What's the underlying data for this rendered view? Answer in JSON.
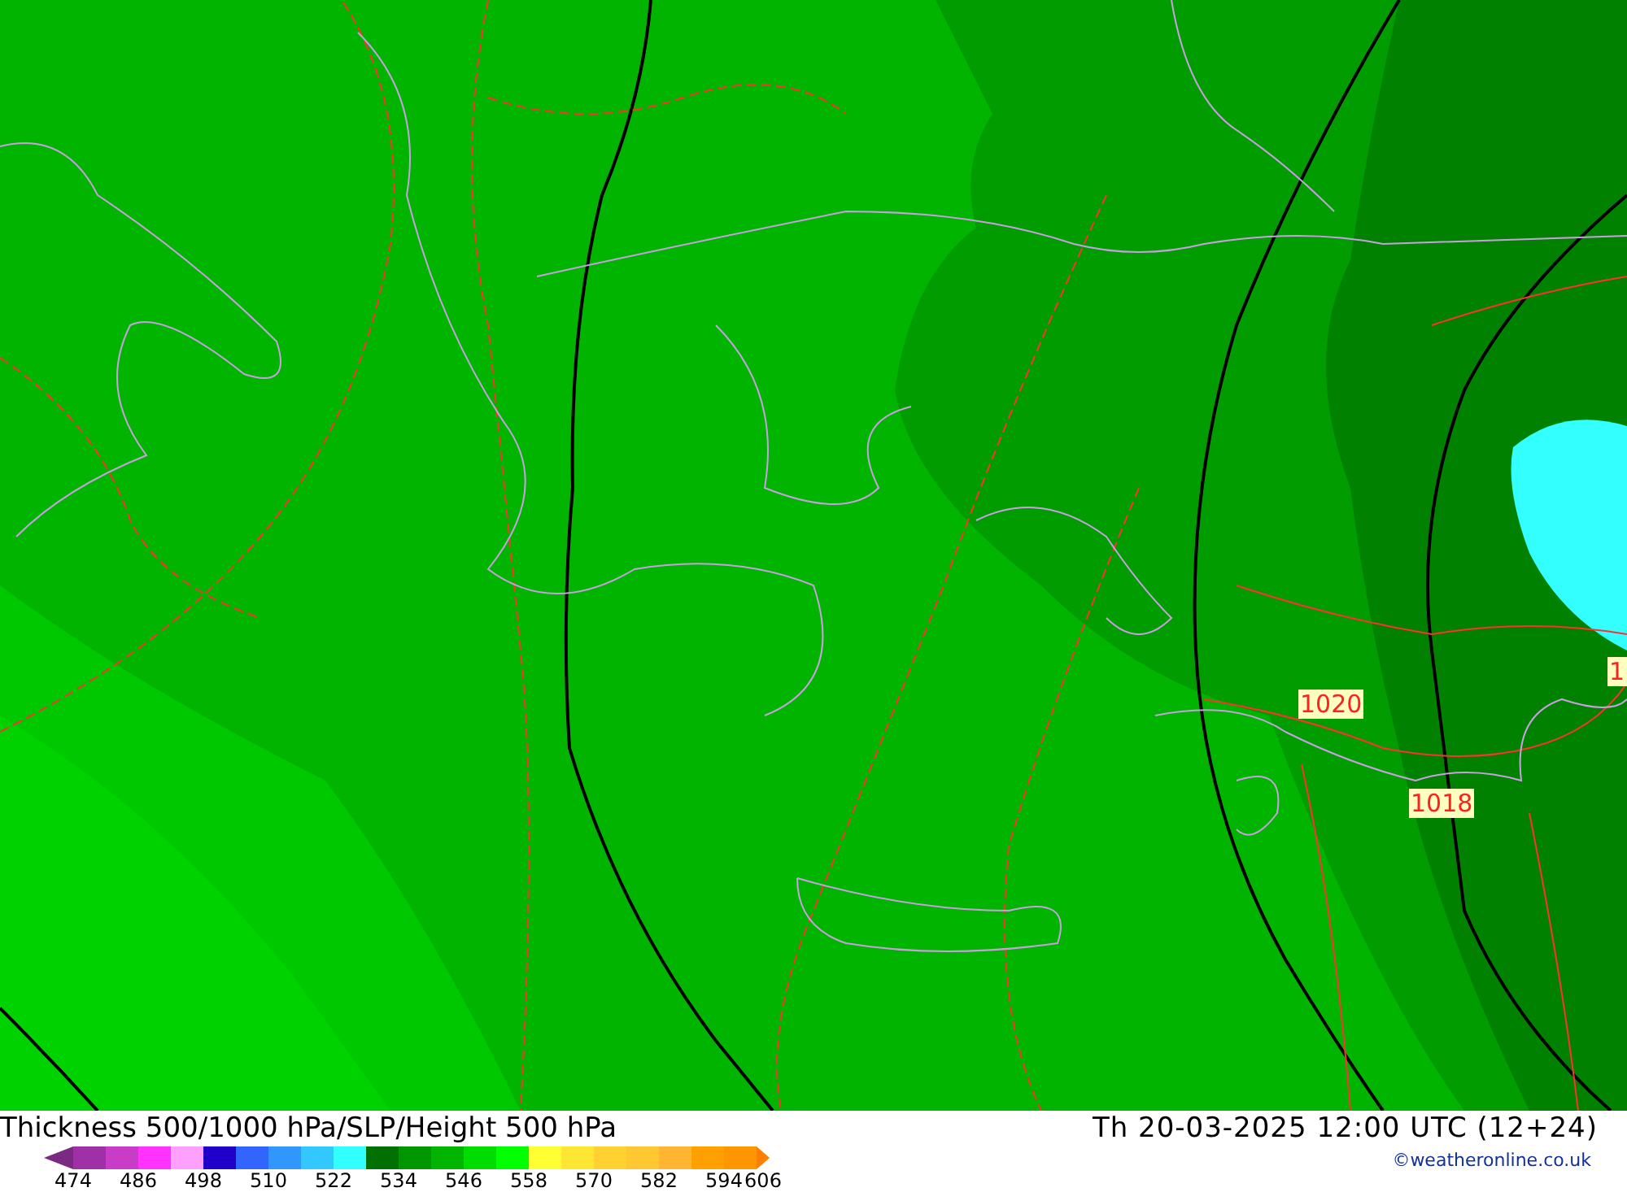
{
  "map": {
    "pressure_labels": [
      {
        "text": "1020"
      },
      {
        "text": "1018"
      },
      {
        "text": "1"
      }
    ]
  },
  "footer": {
    "title": "Thickness 500/1000 hPa/SLP/Height 500 hPa",
    "datetime": "Th 20-03-2025 12:00 UTC (12+24)",
    "credit": "©weatheronline.co.uk"
  },
  "legend": {
    "start_arrow": {
      "color": "#7a2a80"
    },
    "end_arrow": {
      "color": "#ff8000"
    },
    "end_tick": "606",
    "swatches": [
      {
        "color": "#a030a8",
        "tick": "474"
      },
      {
        "color": "#c83cc8"
      },
      {
        "color": "#ff32ff",
        "tick": "486"
      },
      {
        "color": "#ffa0ff"
      },
      {
        "color": "#1e00c8",
        "tick": "498"
      },
      {
        "color": "#3264ff"
      },
      {
        "color": "#3296ff",
        "tick": "510"
      },
      {
        "color": "#32c8ff"
      },
      {
        "color": "#32ffff",
        "tick": "522"
      },
      {
        "color": "#007000"
      },
      {
        "color": "#009600",
        "tick": "534"
      },
      {
        "color": "#00b400"
      },
      {
        "color": "#00dc00",
        "tick": "546"
      },
      {
        "color": "#00ff00"
      },
      {
        "color": "#ffff32",
        "tick": "558"
      },
      {
        "color": "#ffe632"
      },
      {
        "color": "#ffd232",
        "tick": "570"
      },
      {
        "color": "#ffc832"
      },
      {
        "color": "#ffb432",
        "tick": "582"
      },
      {
        "color": "#ffa000"
      },
      {
        "color": "#ff9600",
        "tick": "594"
      }
    ]
  }
}
